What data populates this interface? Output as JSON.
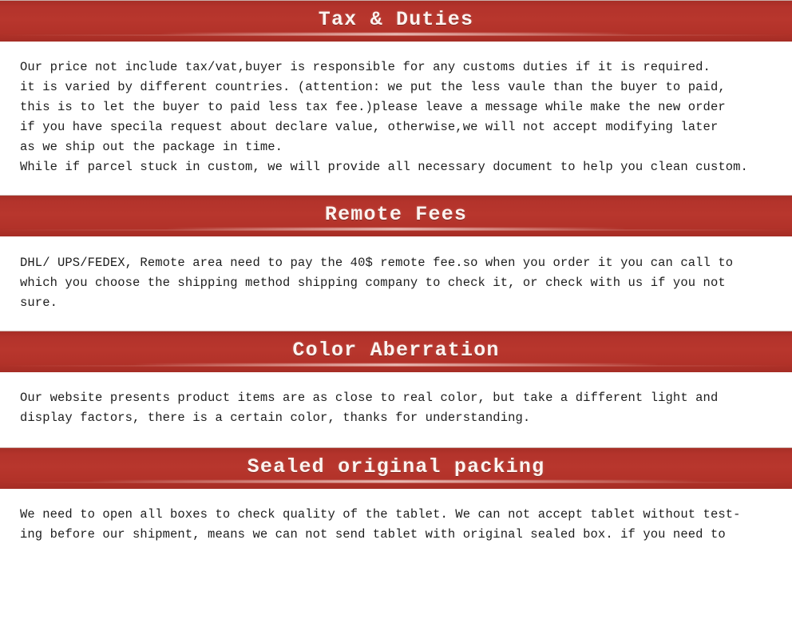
{
  "page": {
    "background": "#ffffff",
    "banner_color": "#b4322a",
    "banner_text_color": "#fdf3ef",
    "body_text_color": "#1d1d1d"
  },
  "sections": [
    {
      "id": "tax-and-duties",
      "title": "Tax & Duties",
      "body": "Our price not include tax/vat,buyer is responsible for any customs duties if it is required.\nit is varied by different countries. (attention: we put the less vaule than the buyer to paid,\nthis is to let the buyer to paid less tax fee.)please leave a message while make the new order\nif you have specila request about declare value, otherwise,we will not accept modifying later\nas we ship out the package in time.\nWhile if parcel stuck in custom, we will provide all necessary document to help you clean custom."
    },
    {
      "id": "remote-fees",
      "title": "Remote Fees",
      "body": "DHL/ UPS/FEDEX, Remote area need to pay the 40$ remote fee.so when you order it you can call to\nwhich you choose the shipping method shipping company to check it, or check with us if you not\nsure."
    },
    {
      "id": "color-aberration",
      "title": "Color Aberration",
      "body": "Our website presents product items are as close to real color, but take a different light and\ndisplay factors, there is a certain color, thanks for understanding."
    },
    {
      "id": "sealed-original-packing",
      "title": "Sealed original packing",
      "body": "We need to open all boxes to check quality of the tablet. We can not accept tablet without test-\ning before our shipment, means we can not send tablet with original sealed box. if you need to"
    }
  ]
}
